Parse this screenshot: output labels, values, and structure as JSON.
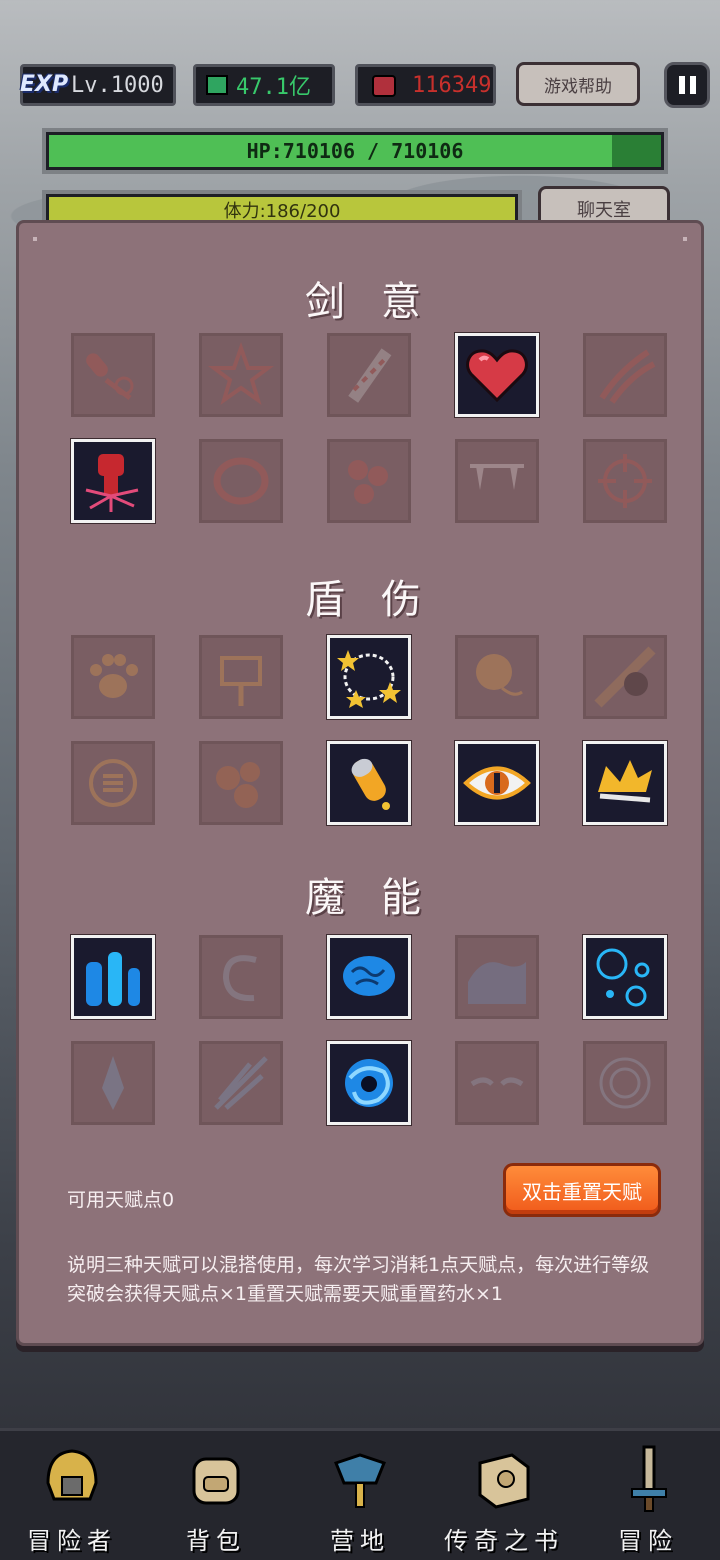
{
  "hud": {
    "exp_badge": "EXP",
    "level": "Lv.1000",
    "jade": "47.1亿",
    "rubies": "116349",
    "help_label": "游戏帮助",
    "hp_text": "HP:710106 / 710106",
    "stamina_text": "体力:186/200",
    "chat_label": "聊天室"
  },
  "talents": {
    "sections": [
      {
        "title": "剑意",
        "icons": [
          [
            "club-icon",
            "star-figure-icon",
            "bandaged-sword-icon",
            "heart-icon",
            "claw-slash-icon"
          ],
          [
            "fist-icon",
            "ring-icon",
            "meat-icon",
            "fangs-icon",
            "crosshair-icon"
          ]
        ],
        "active": [
          [
            false,
            false,
            false,
            true,
            false
          ],
          [
            true,
            false,
            false,
            false,
            false
          ]
        ]
      },
      {
        "title": "盾伤",
        "icons": [
          [
            "paw-icon",
            "signpost-icon",
            "star-ring-icon",
            "sack-icon",
            "boulder-icon"
          ],
          [
            "shield-emblem-icon",
            "rocks-icon",
            "bullet-icon",
            "eye-icon",
            "crown-icon"
          ]
        ],
        "active": [
          [
            false,
            false,
            true,
            false,
            false
          ],
          [
            false,
            false,
            true,
            true,
            true
          ]
        ]
      },
      {
        "title": "魔能",
        "icons": [
          [
            "crystals-icon",
            "swirl-icon",
            "brain-icon",
            "wave-icon",
            "bubbles-icon"
          ],
          [
            "ice-shard-icon",
            "arrow-burst-icon",
            "vortex-icon",
            "masked-eyes-icon",
            "rune-icon"
          ]
        ],
        "active": [
          [
            true,
            false,
            true,
            false,
            true
          ],
          [
            false,
            false,
            true,
            false,
            false
          ]
        ]
      }
    ],
    "points_label": "可用天赋点0",
    "reset_label": "双击重置天赋",
    "description": "说明三种天赋可以混搭使用，每次学习消耗1点天赋点，每次进行等级突破会获得天赋点×1重置天赋需要天赋重置药水×1"
  },
  "nav": [
    {
      "label": "冒险者",
      "icon": "adventurer-icon"
    },
    {
      "label": "背包",
      "icon": "backpack-icon"
    },
    {
      "label": "营地",
      "icon": "camp-icon"
    },
    {
      "label": "传奇之书",
      "icon": "legend-book-icon"
    },
    {
      "label": "冒险",
      "icon": "sword-icon"
    }
  ],
  "colors": {
    "panel": "#8d7279",
    "locked_cell": "#7a5e63",
    "active_cell": "#1a1a2e",
    "hp": "#4fbf55",
    "jade_text": "#38c96b",
    "ruby_text": "#c8302c",
    "reset_button": "#f26a22"
  }
}
